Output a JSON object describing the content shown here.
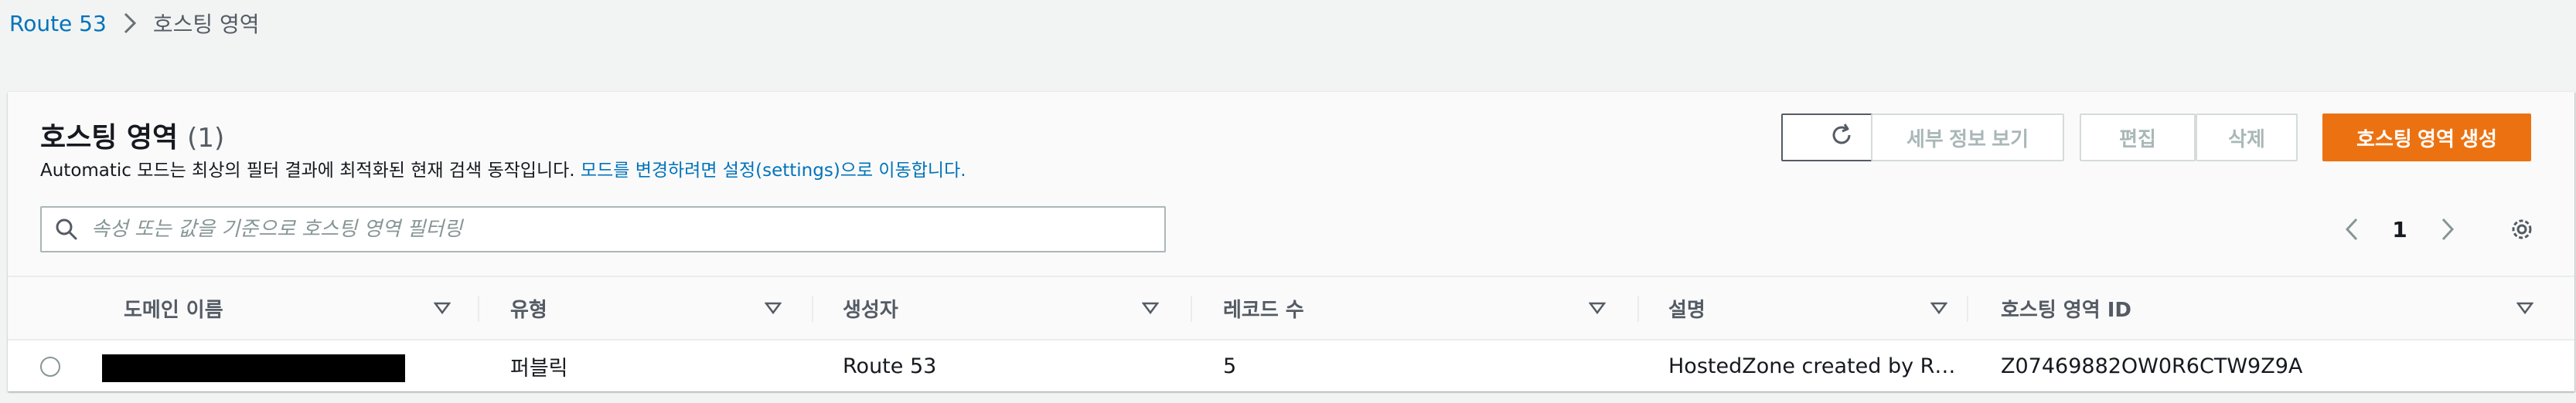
{
  "breadcrumb": {
    "items": [
      "Route 53",
      "호스팅 영역"
    ]
  },
  "panel": {
    "title": "호스팅 영역",
    "count": "(1)",
    "subtitle_prefix": "Automatic 모드는 최상의 필터 결과에 최적화된 현재 검색 동작입니다. ",
    "subtitle_link": "모드를 변경하려면 설정(settings)으로 이동합니다.",
    "buttons": {
      "refresh_icon": "refresh-icon",
      "view_details": "세부 정보 보기",
      "edit": "편집",
      "delete": "삭제",
      "create": "호스팅 영역 생성"
    },
    "search": {
      "placeholder": "속성 또는 값을 기준으로 호스팅 영역 필터링",
      "value": ""
    },
    "pagination": {
      "current_page": "1"
    }
  },
  "table": {
    "columns": [
      "도메인 이름",
      "유형",
      "생성자",
      "레코드 수",
      "설명",
      "호스팅 영역 ID"
    ],
    "rows": [
      {
        "domain": "",
        "type": "퍼블릭",
        "created_by": "Route 53",
        "record_count": "5",
        "description": "HostedZone created by R…",
        "zone_id": "Z07469882OW0R6CTW9Z9A"
      }
    ]
  },
  "colors": {
    "link": "#0073bb",
    "primary": "#ec7211",
    "text": "#16191f",
    "muted": "#545b64"
  }
}
